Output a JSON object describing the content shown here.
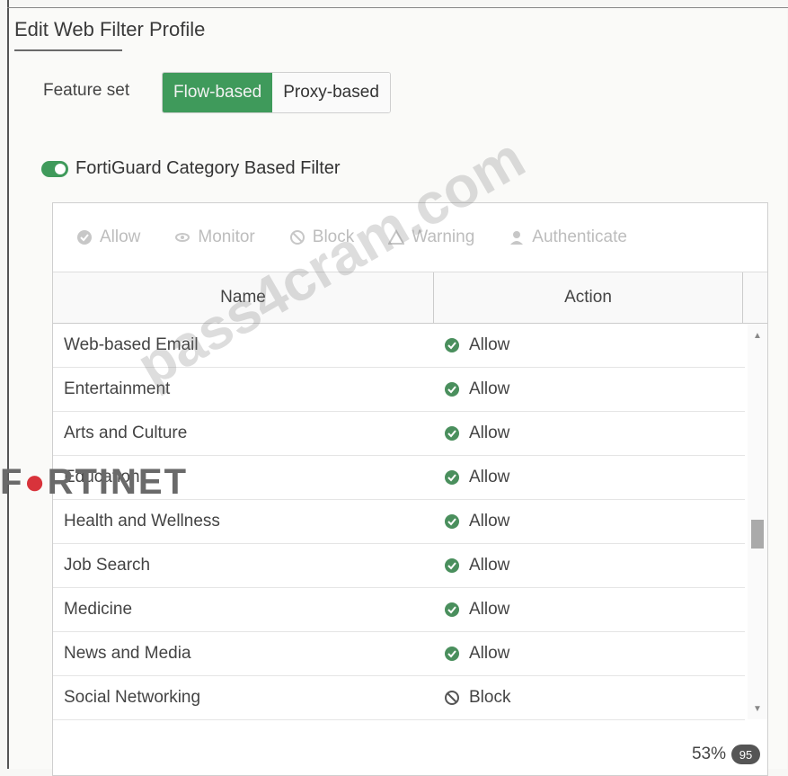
{
  "header": {
    "title": "Edit Web Filter Profile"
  },
  "feature_set": {
    "label": "Feature set",
    "options": [
      "Flow-based",
      "Proxy-based"
    ],
    "selected": "Flow-based"
  },
  "fortiguard": {
    "label": "FortiGuard Category Based Filter",
    "enabled": true
  },
  "actions_toolbar": {
    "allow": "Allow",
    "monitor": "Monitor",
    "block": "Block",
    "warning": "Warning",
    "authenticate": "Authenticate"
  },
  "table": {
    "columns": [
      "Name",
      "Action"
    ],
    "rows": [
      {
        "name": "Web-based Email",
        "action": "Allow"
      },
      {
        "name": "Entertainment",
        "action": "Allow"
      },
      {
        "name": "Arts and Culture",
        "action": "Allow"
      },
      {
        "name": "Education",
        "action": "Allow"
      },
      {
        "name": "Health and Wellness",
        "action": "Allow"
      },
      {
        "name": "Job Search",
        "action": "Allow"
      },
      {
        "name": "Medicine",
        "action": "Allow"
      },
      {
        "name": "News and Media",
        "action": "Allow"
      },
      {
        "name": "Social Networking",
        "action": "Block"
      }
    ],
    "footer": {
      "percent": "53%",
      "count": "95"
    }
  },
  "colors": {
    "accent": "#3f9a5b",
    "allow": "#4a8f5d",
    "block": "#555555",
    "logo_red": "#d8333b"
  },
  "branding": {
    "logo": "FORTINET",
    "watermark": "pass4cram.com"
  }
}
